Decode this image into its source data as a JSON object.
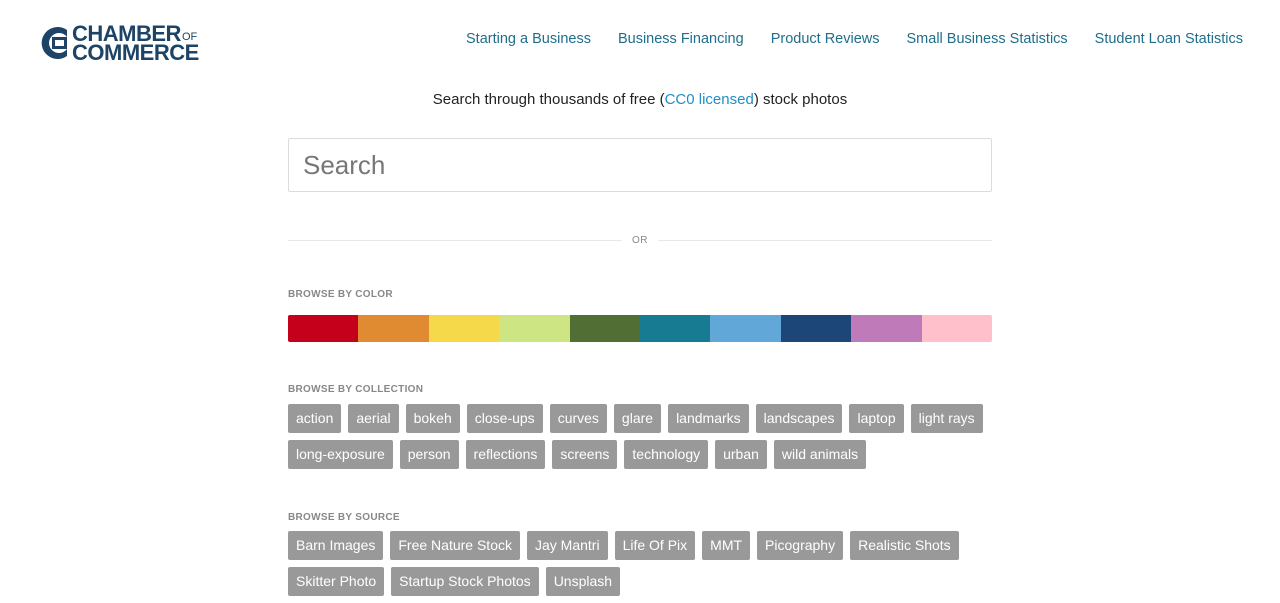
{
  "logo": {
    "line1": "CHAMBER",
    "of": "OF",
    "line2": "COMMERCE",
    "brand_color": "#1d4466"
  },
  "nav": [
    {
      "label": "Starting a Business"
    },
    {
      "label": "Business Financing"
    },
    {
      "label": "Product Reviews"
    },
    {
      "label": "Small Business Statistics"
    },
    {
      "label": "Student Loan Statistics"
    }
  ],
  "tagline": {
    "before": "Search through thousands of free (",
    "link": "CC0 licensed",
    "after": ") stock photos"
  },
  "search": {
    "placeholder": "Search",
    "value": ""
  },
  "divider": {
    "label": "OR"
  },
  "browse_color": {
    "label": "BROWSE BY COLOR",
    "colors": [
      "#c4001a",
      "#e08a32",
      "#f6d94a",
      "#cde583",
      "#516e35",
      "#177b92",
      "#61a8d8",
      "#1b4677",
      "#be7ab9",
      "#ffc0cb"
    ]
  },
  "browse_collection": {
    "label": "BROWSE BY COLLECTION",
    "tags": [
      "action",
      "aerial",
      "bokeh",
      "close-ups",
      "curves",
      "glare",
      "landmarks",
      "landscapes",
      "laptop",
      "light rays",
      "long-exposure",
      "person",
      "reflections",
      "screens",
      "technology",
      "urban",
      "wild animals"
    ]
  },
  "browse_source": {
    "label": "BROWSE BY SOURCE",
    "tags": [
      "Barn Images",
      "Free Nature Stock",
      "Jay Mantri",
      "Life Of Pix",
      "MMT",
      "Picography",
      "Realistic Shots",
      "Skitter Photo",
      "Startup Stock Photos",
      "Unsplash"
    ]
  },
  "colors": {
    "link": "#1f6e8a",
    "tag_bg": "#999999"
  }
}
